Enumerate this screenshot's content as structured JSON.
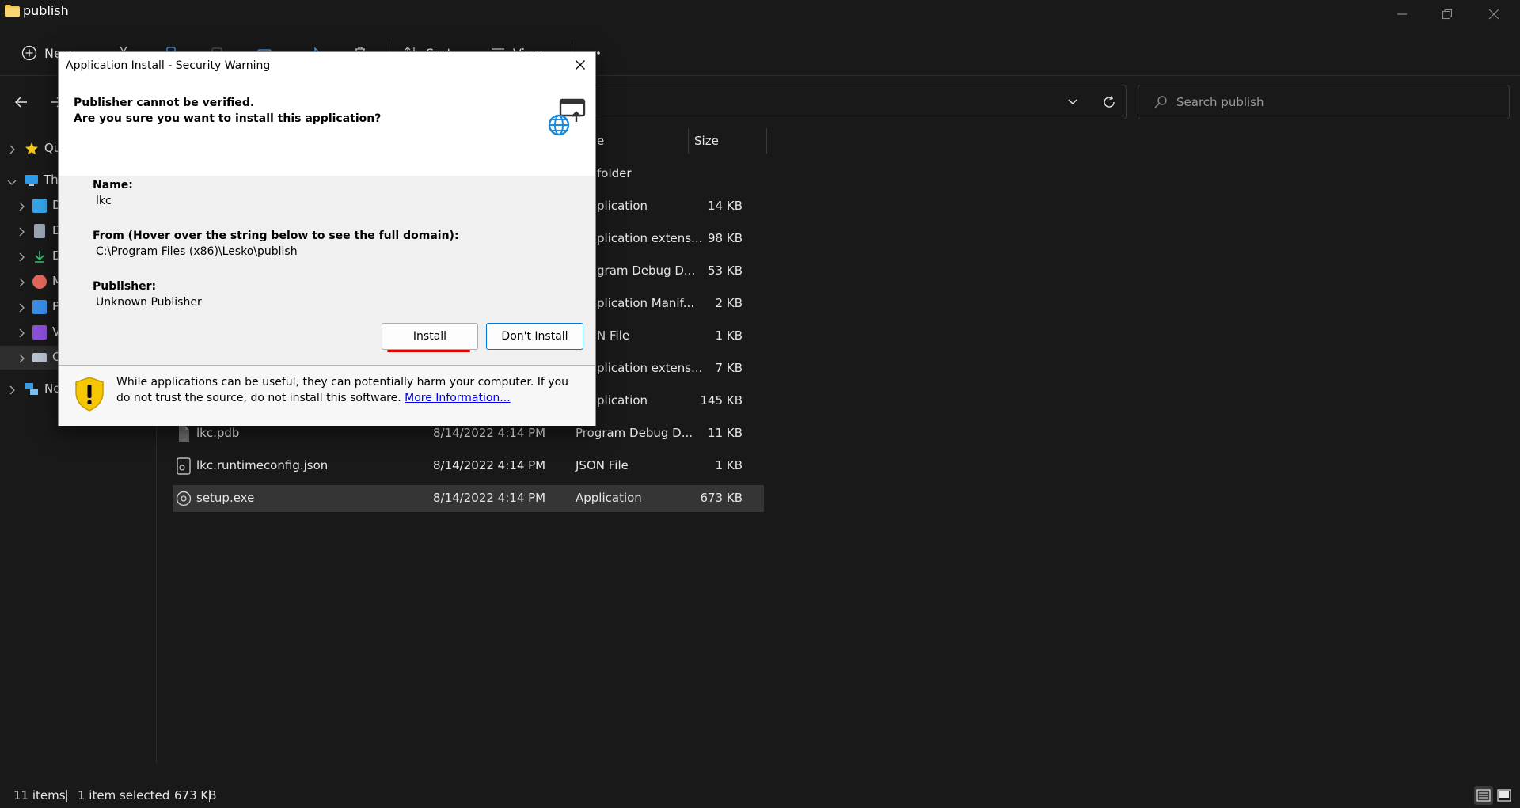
{
  "window": {
    "title": "publish",
    "minimize_icon": "minimize-icon",
    "maximize_icon": "restore-icon",
    "close_icon": "close-icon"
  },
  "toolbar": {
    "new_label": "New",
    "sort_label": "Sort",
    "view_label": "View"
  },
  "search": {
    "placeholder": "Search publish"
  },
  "sidebar": {
    "items": [
      {
        "label": "Qu",
        "icon": "star-icon",
        "color": "#f5c518"
      },
      {
        "label": "Th",
        "icon": "monitor-icon",
        "color": "#2f9be8"
      },
      {
        "label": "D",
        "icon": "desktop-icon",
        "color": "#36a2e6"
      },
      {
        "label": "D",
        "icon": "document-icon",
        "color": "#9aa5b3"
      },
      {
        "label": "D",
        "icon": "download-icon",
        "color": "#38c172"
      },
      {
        "label": "M",
        "icon": "music-icon",
        "color": "#e0675a"
      },
      {
        "label": "P",
        "icon": "pictures-icon",
        "color": "#3a8ee6"
      },
      {
        "label": "V",
        "icon": "videos-icon",
        "color": "#8a4fd8"
      },
      {
        "label": "C",
        "icon": "drive-icon",
        "color": "#b7c2cf"
      },
      {
        "label": "Ne",
        "icon": "network-icon",
        "color": "#3b9de0"
      }
    ]
  },
  "columns": {
    "type_partial": "e",
    "size": "Size"
  },
  "rows": [
    {
      "name": "",
      "date": "",
      "type": "folder",
      "size": ""
    },
    {
      "name": "",
      "date": "",
      "type": "plication",
      "size": "14 KB"
    },
    {
      "name": "",
      "date": "",
      "type": "plication extens...",
      "size": "98 KB"
    },
    {
      "name": "",
      "date": "",
      "type": "gram Debug D...",
      "size": "53 KB"
    },
    {
      "name": "",
      "date": "",
      "type": "plication Manif...",
      "size": "2 KB"
    },
    {
      "name": "",
      "date": "",
      "type": "N File",
      "size": "1 KB"
    },
    {
      "name": "",
      "date": "",
      "type": "plication extens...",
      "size": "7 KB"
    },
    {
      "name": "",
      "date": "",
      "type": "plication",
      "size": "145 KB"
    },
    {
      "name": "lkc.pdb",
      "date": "8/14/2022 4:14 PM",
      "type": "Program Debug D...",
      "size": "11 KB"
    },
    {
      "name": "lkc.runtimeconfig.json",
      "date": "8/14/2022 4:14 PM",
      "type": "JSON File",
      "size": "1 KB"
    },
    {
      "name": "setup.exe",
      "date": "8/14/2022 4:14 PM",
      "type": "Application",
      "size": "673 KB"
    }
  ],
  "status": {
    "items": "11 items",
    "selected": "1 item selected",
    "size": "673 KB"
  },
  "dialog": {
    "title": "Application Install - Security Warning",
    "header_line1": "Publisher cannot be verified.",
    "header_line2": "Are you sure you want to install this application?",
    "name_label": "Name:",
    "name_value": "lkc",
    "from_label": "From (Hover over the string below to see the full domain):",
    "from_value": "C:\\Program Files (x86)\\Lesko\\publish",
    "publisher_label": "Publisher:",
    "publisher_value": "Unknown Publisher",
    "install_label": "Install",
    "dont_install_label": "Don't Install",
    "warning_text": "While applications can be useful, they can potentially harm your computer. If you do not trust the source, do not install this software.",
    "more_info_label": "More Information...",
    "colors": {
      "link": "#0000ee",
      "focus_border": "#0078d4",
      "annotation": "#e00000",
      "shield": "#f6c700"
    }
  }
}
